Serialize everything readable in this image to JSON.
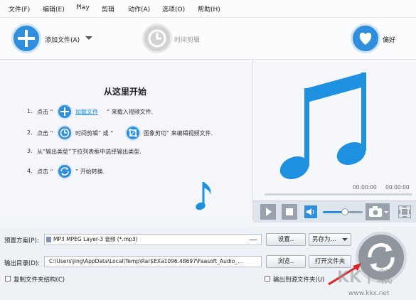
{
  "menu": [
    "文件(F)",
    "编辑(E)",
    "Play",
    "剪辑",
    "动作(A)",
    "选项(O)",
    "帮助(H)"
  ],
  "toolbar": {
    "add_file": "添加文件(A)",
    "time_clip": "时间剪辑",
    "favorite": "偏好"
  },
  "guide": {
    "title": "从这里开始",
    "step1_num": "1.",
    "step1_pre": "点击 “",
    "step1_link": "加载文件",
    "step1_post": "” 来载入视频文件.",
    "step2_num": "2.",
    "step2_pre": "点击 “",
    "step2_mid": "时间剪辑” 或 “",
    "step2_post": "图象剪切” 来编辑视频文件.",
    "step3_num": "3.",
    "step3_text": "从“输出类型”下拉列表框中选择输出类型.",
    "step4_num": "4.",
    "step4_pre": "点击 “",
    "step4_post": "” 开始转换."
  },
  "player": {
    "time_current": "00:00:00",
    "time_total": "00:00:00",
    "volume_level": 0.55,
    "progress": 0.0
  },
  "preset": {
    "label": "预置方案(P):",
    "value": "MP3 MPEG Layer-3 音频 (*.mp3)",
    "settings_btn": "设置..",
    "saveas_btn": "另存为..."
  },
  "output": {
    "label": "输出目录(D):",
    "value": "C:\\Users\\jing\\AppData\\Local\\Temp\\Rar$EXa1096.48697\\Faasoft_Audio_...",
    "browse_btn": "浏览..",
    "open_folder_btn": "打开文件夹"
  },
  "options": {
    "copy_structure": "复制文件夹结构(C)",
    "output_to_source": "输出到源文件夹(U)"
  },
  "watermark": {
    "brand": "KK下载",
    "url": "www.kkx.net"
  },
  "colors": {
    "accent": "#2f8fdc",
    "note": "#1e90e0"
  }
}
